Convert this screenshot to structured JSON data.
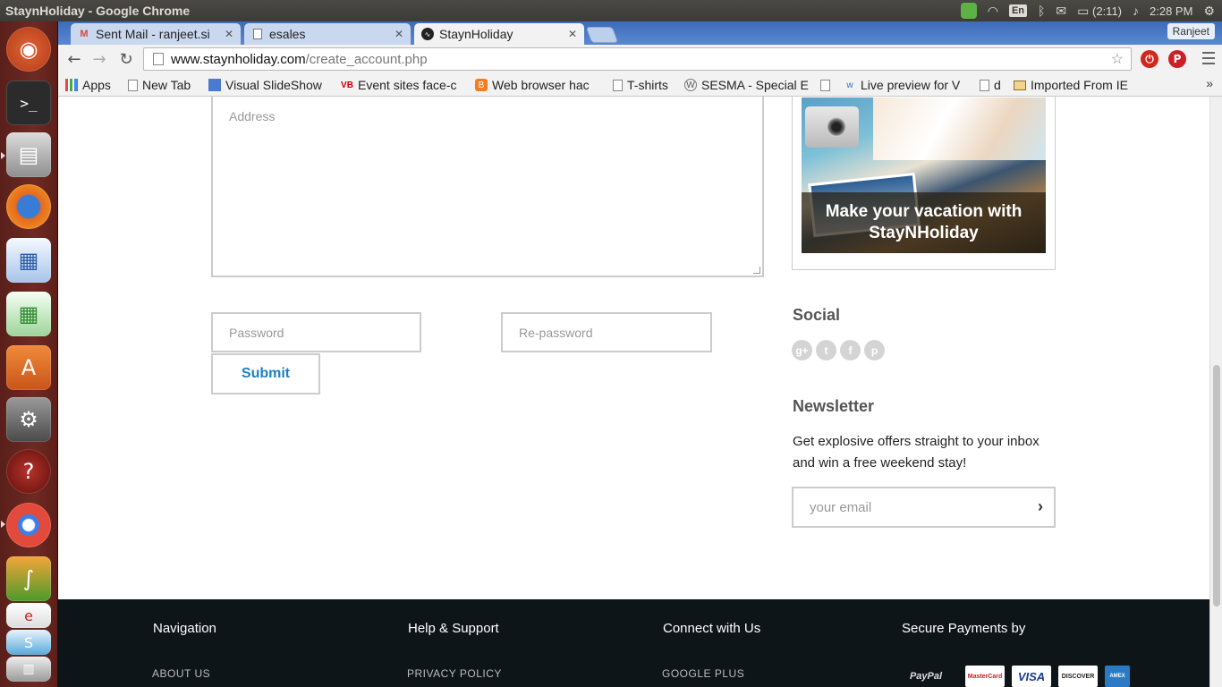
{
  "os": {
    "window_title": "StaynHoliday - Google Chrome",
    "language": "En",
    "battery": "(2:11)",
    "time": "2:28 PM"
  },
  "browser": {
    "profile": "Ranjeet",
    "tabs": [
      {
        "label": "Sent Mail - ranjeet.si",
        "icon": "gmail-icon"
      },
      {
        "label": "esales",
        "icon": "page-icon"
      },
      {
        "label": "StaynHoliday",
        "icon": "staynholiday-icon"
      }
    ],
    "url_host": "www.staynholiday.com",
    "url_path": "/create_account.php",
    "bookmarks": [
      "Apps",
      "New Tab",
      "Visual SlideShow",
      "Event sites face-c",
      "Web browser hac",
      "T-shirts",
      "SESMA - Special E",
      "",
      "Live preview for V",
      "d",
      "Imported From IE"
    ],
    "bookmarks_more": "»"
  },
  "form": {
    "address_placeholder": "Address",
    "password_placeholder": "Password",
    "repassword_placeholder": "Re-password",
    "submit_label": "Submit"
  },
  "sidebar": {
    "promo_caption": "Make your vacation with StayNHoliday",
    "social_heading": "Social",
    "social_icons": [
      "g+",
      "t",
      "f",
      "p"
    ],
    "newsletter_heading": "Newsletter",
    "newsletter_text": "Get explosive offers straight to your inbox and win a free weekend stay!",
    "email_placeholder": "your email",
    "email_go": "›"
  },
  "footer": {
    "columns": [
      {
        "title": "Navigation",
        "link": "ABOUT US"
      },
      {
        "title": "Help & Support",
        "link": "PRIVACY POLICY"
      },
      {
        "title": "Connect with Us",
        "link": "GOOGLE PLUS"
      },
      {
        "title": "Secure Payments by",
        "link": ""
      }
    ],
    "payments": [
      "PayPal",
      "MasterCard",
      "VISA",
      "DISCOVER",
      "AMEX"
    ]
  },
  "colors": {
    "accent_blue": "#1b7fc4",
    "footer_bg": "#0e1519",
    "launcher_bg": "#6e2a22"
  }
}
